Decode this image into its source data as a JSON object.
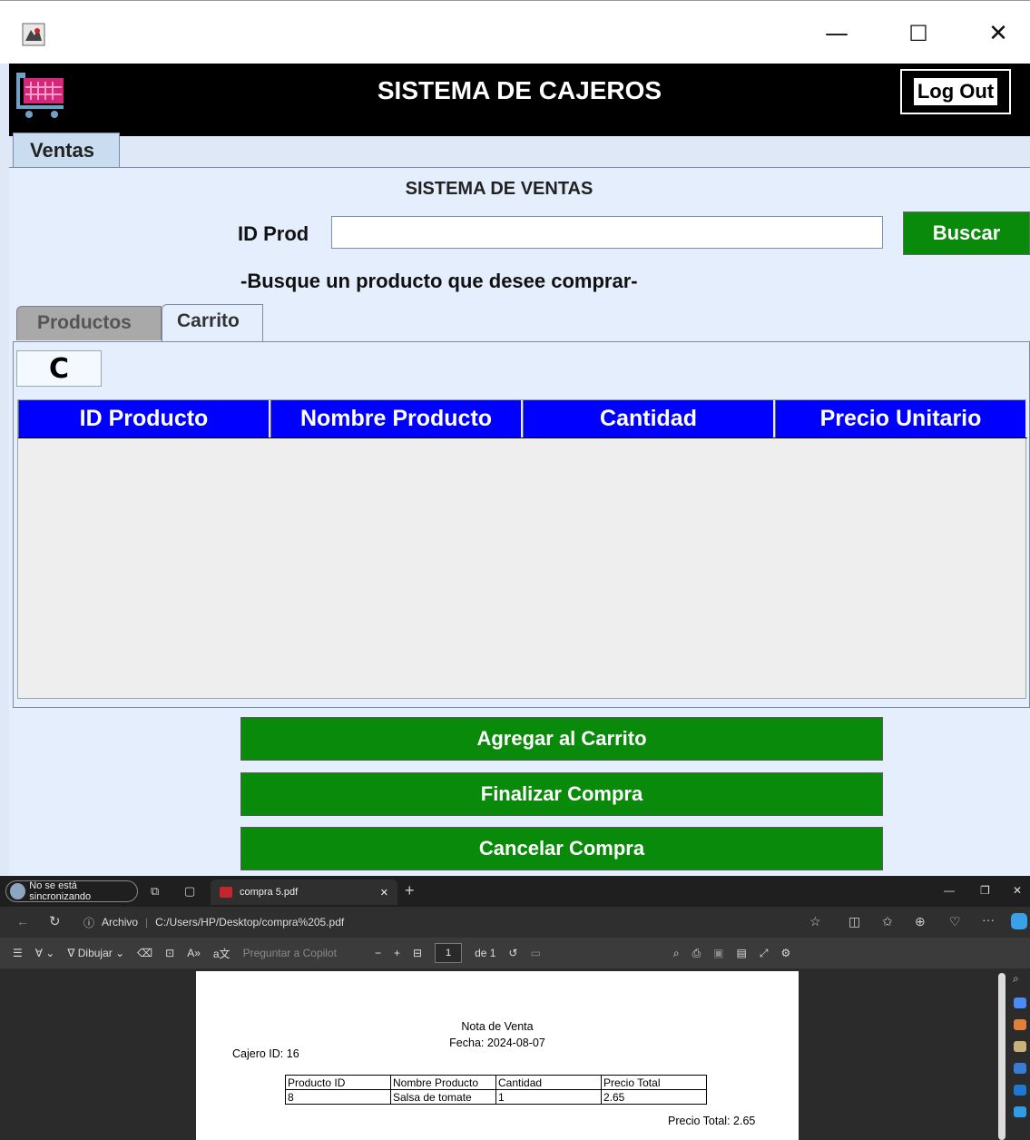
{
  "app": {
    "header_title": "SISTEMA DE CAJEROS",
    "logout_label": "Log Out",
    "main_tab": "Ventas",
    "section_title": "SISTEMA DE VENTAS",
    "search_label": "ID Prod",
    "search_value": "",
    "search_button": "Buscar",
    "hint": "-Busque un producto que desee comprar-",
    "subtabs": [
      {
        "label": "Productos"
      },
      {
        "label": "Carrito"
      }
    ],
    "refresh_icon": "C",
    "table": {
      "columns": [
        "ID Producto",
        "Nombre Producto",
        "Cantidad",
        "Precio Unitario"
      ],
      "rows": []
    },
    "buttons": {
      "add": "Agregar al Carrito",
      "finish": "Finalizar Compra",
      "cancel": "Cancelar Compra"
    },
    "window_controls": {
      "minimize": "—",
      "maximize": "☐",
      "close": "✕"
    }
  },
  "browser": {
    "sync_label": "No se está sincronizando",
    "tab_title": "compra 5.pdf",
    "address_label": "Archivo",
    "address_url": "C:/Users/HP/Desktop/compra%205.pdf",
    "toolbar": {
      "draw_label": "Dibujar",
      "copilot_label": "Preguntar a Copilot",
      "page_number": "1",
      "page_total": "de 1"
    },
    "window_controls": {
      "minimize": "—",
      "restore": "❐",
      "close": "✕"
    }
  },
  "pdf": {
    "title": "Nota de Venta",
    "date": "Fecha: 2024-08-07",
    "cashier": "Cajero ID: 16",
    "columns": [
      "Producto ID",
      "Nombre Producto",
      "Cantidad",
      "Precio Total"
    ],
    "rows": [
      [
        "8",
        "Salsa de tomate",
        "1",
        "2.65"
      ]
    ],
    "total": "Precio Total: 2.65"
  }
}
